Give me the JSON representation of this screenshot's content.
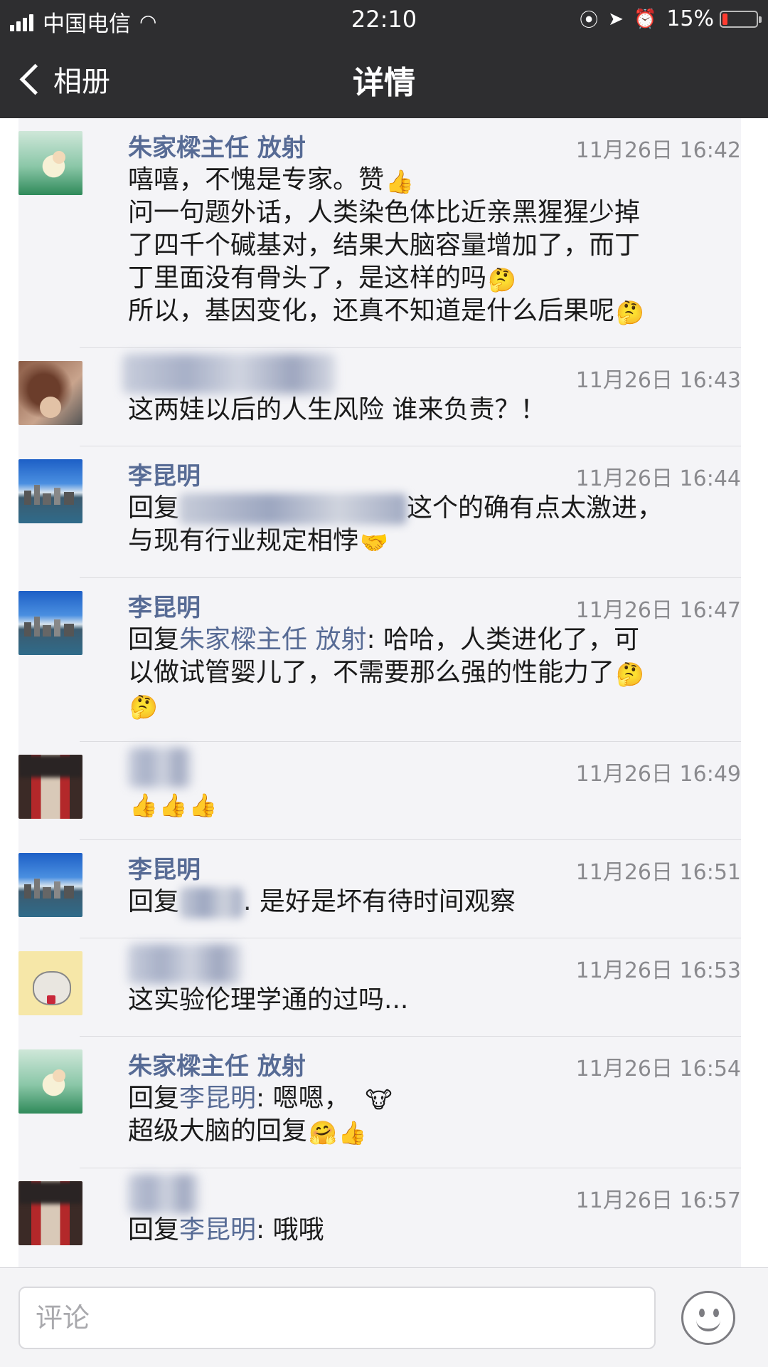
{
  "status_bar": {
    "carrier": "中国电信",
    "time": "22:10",
    "battery_percent": "15%"
  },
  "nav": {
    "back_label": "相册",
    "title": "详情"
  },
  "comments": [
    {
      "name": "朱家樑主任 放射",
      "time": "11月26日 16:42",
      "lines": [
        "嘻嘻，不愧是专家。赞",
        "问一句题外话，人类染色体比近亲黑猩猩少掉",
        "了四千个碱基对，结果大脑容量增加了，而丁",
        "丁里面没有骨头了，是这样的吗",
        "所以，基因变化，还真不知道是什么后果呢"
      ]
    },
    {
      "name": "",
      "time": "11月26日 16:43",
      "lines": [
        "这两娃以后的人生风险 谁来负责？！"
      ]
    },
    {
      "name": "李昆明",
      "time": "11月26日 16:44",
      "reply_prefix": "回复",
      "lines_after": "这个的确有点太激进，",
      "line2": "与现有行业规定相悖"
    },
    {
      "name": "李昆明",
      "time": "11月26日 16:47",
      "reply_prefix": "回复",
      "reply_to": "朱家樑主任 放射",
      "text": ": 哈哈，人类进化了，可",
      "line2": "以做试管婴儿了，不需要那么强的性能力了"
    },
    {
      "name": "",
      "time": "11月26日 16:49"
    },
    {
      "name": "李昆明",
      "time": "11月26日 16:51",
      "reply_prefix": "回复",
      "text": ". 是好是坏有待时间观察"
    },
    {
      "name": "",
      "time": "11月26日 16:53",
      "text": "这实验伦理学通的过吗..."
    },
    {
      "name": "朱家樑主任 放射",
      "time": "11月26日 16:54",
      "reply_prefix": "回复",
      "reply_to": "李昆明",
      "text": ": 嗯嗯，",
      "line2": "超级大脑的回复"
    },
    {
      "name": "",
      "time": "11月26日 16:57",
      "reply_prefix": "回复",
      "reply_to": "李昆明",
      "text": ": 哦哦"
    }
  ],
  "input": {
    "placeholder": "评论"
  },
  "icons": {
    "thumbs_up": "thumbs-up-emoji",
    "thinking": "thinking-emoji",
    "handshake": "handshake-emoji",
    "cow": "cow-emoji",
    "hug": "hugging-emoji",
    "smiley": "smiley-icon"
  },
  "colors": {
    "nav_bg": "#2e2e30",
    "name_blue": "#576b95",
    "time_gray": "#8a8a8e",
    "list_bg": "#f4f4f7"
  }
}
